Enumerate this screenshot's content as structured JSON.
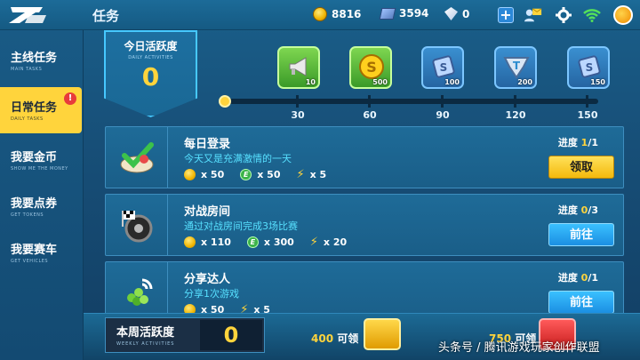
{
  "header": {
    "title": "任务",
    "coins": "8816",
    "tickets": "3594",
    "diamonds": "0"
  },
  "sidebar": {
    "items": [
      {
        "label": "主线任务",
        "sub": "MAIN TASKS"
      },
      {
        "label": "日常任务",
        "sub": "DAILY TASKS",
        "badge": "!"
      },
      {
        "label": "我要金币",
        "sub": "SHOW ME THE MONEY"
      },
      {
        "label": "我要点券",
        "sub": "GET TOKENS"
      },
      {
        "label": "我要赛车",
        "sub": "GET VEHICLES"
      }
    ]
  },
  "daily_activity": {
    "title": "今日活跃度",
    "subtitle": "DAILY ACTIVITIES",
    "value": "0"
  },
  "milestones": [
    {
      "threshold": "30",
      "reward_count": "10",
      "icon": "horn-icon"
    },
    {
      "threshold": "60",
      "reward_count": "500",
      "icon": "coin-icon"
    },
    {
      "threshold": "90",
      "reward_count": "100",
      "icon": "ticket-icon"
    },
    {
      "threshold": "120",
      "reward_count": "200",
      "icon": "trophy-token-icon"
    },
    {
      "threshold": "150",
      "reward_count": "150",
      "icon": "ticket-icon"
    }
  ],
  "tasks": [
    {
      "name": "每日登录",
      "desc": "今天又是充满激情的一天",
      "coins": "x 50",
      "exp": "x 50",
      "energy": "x 5",
      "progress_label": "进度",
      "progress_cur": "1",
      "progress_total": "/1",
      "button": "领取",
      "button_type": "claim"
    },
    {
      "name": "对战房间",
      "desc": "通过对战房间完成3场比赛",
      "coins": "x 110",
      "exp": "x 300",
      "energy": "x 20",
      "progress_label": "进度",
      "progress_cur": "0",
      "progress_total": "/3",
      "button": "前往",
      "button_type": "go"
    },
    {
      "name": "分享达人",
      "desc": "分享1次游戏",
      "coins": "x 50",
      "exp": "",
      "energy": "x 5",
      "progress_label": "进度",
      "progress_cur": "0",
      "progress_total": "/1",
      "button": "前往",
      "button_type": "go"
    }
  ],
  "weekly": {
    "title": "本周活跃度",
    "subtitle": "WEEKLY ACTIVITIES",
    "value": "0",
    "req1_num": "400",
    "req1_text": "可领",
    "req2_num": "750",
    "req2_text": "可领"
  },
  "watermark": "头条号 / 腾讯游戏玩家创作联盟",
  "colors": {
    "accent": "#ffd43c",
    "go_button": "#1b8fe2",
    "desc_text": "#57e0ff"
  }
}
